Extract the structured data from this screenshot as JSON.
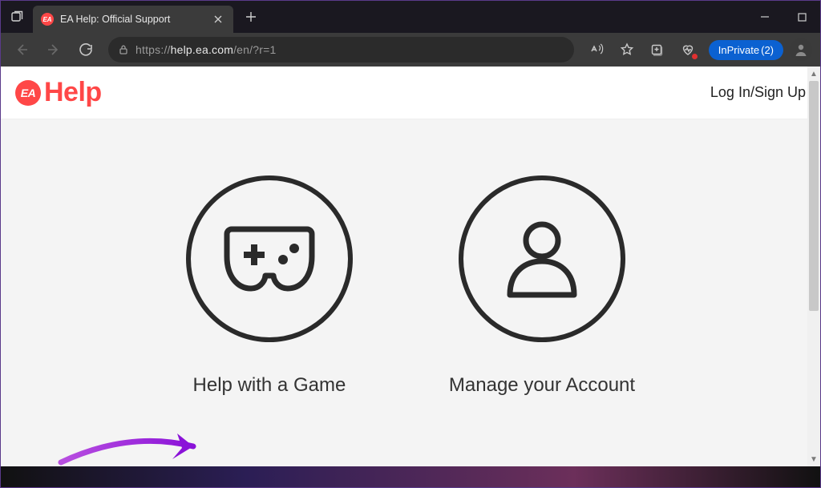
{
  "browser": {
    "tab_title": "EA Help: Official Support",
    "url_scheme": "https://",
    "url_host": "help.ea.com",
    "url_path": "/en/?r=1",
    "inprivate_label": "InPrivate",
    "inprivate_count": "(2)"
  },
  "header": {
    "brand_mark": "EA",
    "brand_word": "Help",
    "login": "Log In/Sign Up"
  },
  "hero": {
    "option_game": "Help with a Game",
    "option_account": "Manage your Account"
  }
}
